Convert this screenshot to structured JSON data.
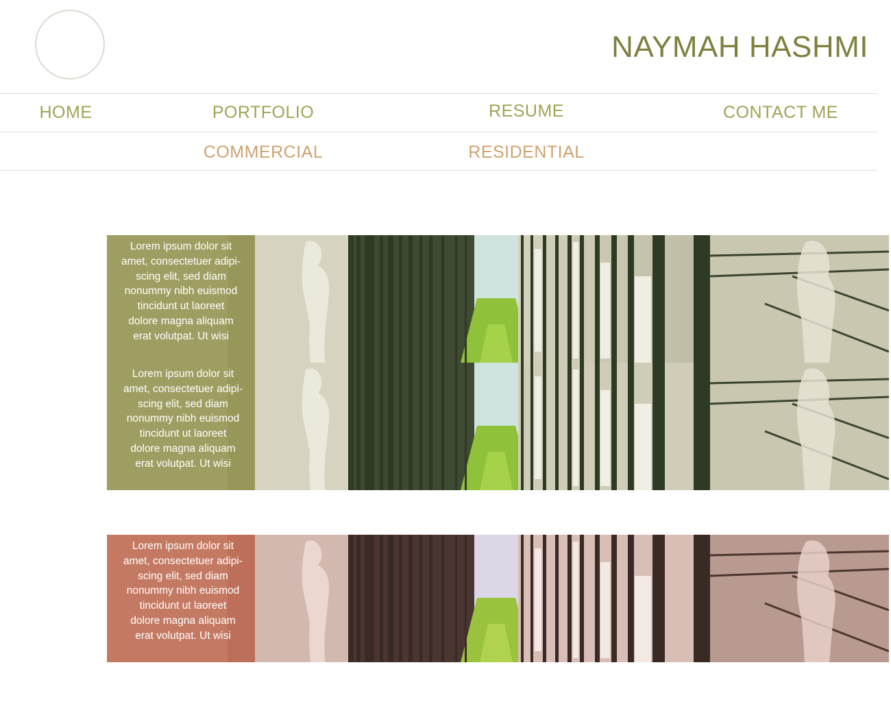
{
  "header": {
    "site_name": "NAYMAH HASHMI"
  },
  "nav": {
    "home": "HOME",
    "portfolio": "PORTFOLIO",
    "resume": "RESUME",
    "contact": "CONTACT ME",
    "sub": {
      "commercial": "COMMERCIAL",
      "residential": "RESIDENTIAL"
    }
  },
  "projects": [
    {
      "caption": "Lorem ipsum dolor sit\namet, consectetuer adipi-\nscing elit, sed diam\nnonummy nibh euismod\ntincidunt ut laoreet\ndolore magna aliquam\nerat volutpat. Ut wisi"
    },
    {
      "caption": "Lorem ipsum dolor sit\namet, consectetuer adipi-\nscing elit, sed diam\nnonummy nibh euismod\ntincidunt ut laoreet\ndolore magna aliquam\nerat volutpat. Ut wisi"
    },
    {
      "caption": "Lorem ipsum dolor sit\namet, consectetuer adipi-\nscing elit, sed diam\nnonummy nibh euismod\ntincidunt ut laoreet\ndolore magna aliquam\nerat volutpat. Ut wisi"
    }
  ],
  "colors": {
    "brand": "#7f8040",
    "nav_main": "#a1a354",
    "nav_sub": "#cfa26f",
    "caption_green": "#9a9a5c",
    "caption_terracotta": "#c4755f"
  }
}
